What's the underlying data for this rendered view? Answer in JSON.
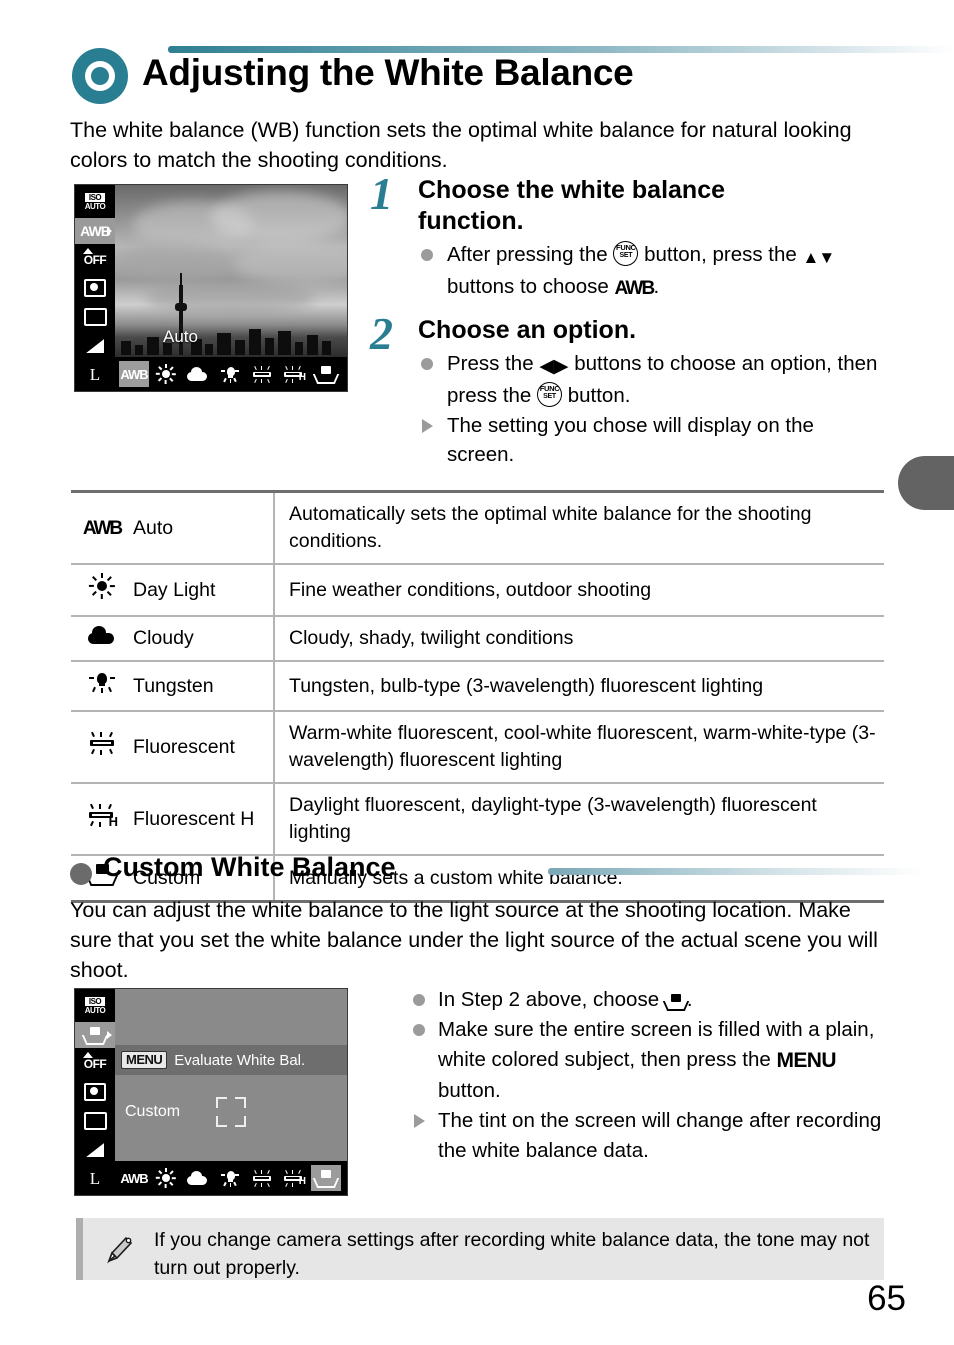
{
  "header": {
    "title": "Adjusting the White Balance",
    "icon": "circle-ring-icon"
  },
  "intro": "The white balance (WB) function sets the optimal white balance for natural looking colors to match the shooting conditions.",
  "camera_screen_1": {
    "rail_icons": [
      "iso-auto-icon",
      "awb-icon",
      "flash-off-icon",
      "metering-icon",
      "drive-frame-icon",
      "compression-wedge-icon",
      "image-size-l-icon"
    ],
    "iso_label_top": "ISO",
    "iso_label_bottom": "AUTO",
    "awb_label": "AWB",
    "flash_off_label": "OFF",
    "size_label": "L",
    "mode_label": "Auto",
    "strip_items": [
      "AWB",
      "day-light-icon",
      "cloudy-icon",
      "tungsten-icon",
      "fluorescent-icon",
      "fluorescent-h-icon",
      "custom-wb-icon"
    ],
    "selected_index": 0
  },
  "steps": [
    {
      "number": "1",
      "heading": "Choose the white balance function.",
      "bullets": [
        {
          "marker": "dot",
          "parts": [
            "After pressing the ",
            "FUNC-SET-button",
            " button, press the ",
            "up-down-arrows",
            " buttons to choose ",
            "AWB-glyph",
            "."
          ]
        }
      ]
    },
    {
      "number": "2",
      "heading": "Choose an option.",
      "bullets": [
        {
          "marker": "dot",
          "parts": [
            "Press the ",
            "left-right-arrows",
            " buttons to choose an option, then press the ",
            "FUNC-SET-button",
            " button."
          ]
        },
        {
          "marker": "triangle",
          "parts": [
            "The setting you chose will display on the screen."
          ]
        }
      ]
    }
  ],
  "step_text": {
    "s1_head_line1": "Choose the white balance",
    "s1_head_line2": "function.",
    "s1_b1_a": "After pressing the",
    "s1_b1_b": "button, press the",
    "s1_b1_c": "buttons to choose",
    "s1_b1_d": ".",
    "s2_head": "Choose an option.",
    "s2_b1_a": "Press the",
    "s2_b1_b": "buttons to choose an option,",
    "s2_b1_c": "then press the",
    "s2_b1_d": "button.",
    "s2_b2": "The setting you chose will display on the screen.",
    "func_top": "FUNC",
    "func_bottom": "SET",
    "up_down": "▲▼",
    "left_right": "◀▶",
    "awb": "AWB"
  },
  "table": {
    "rows": [
      {
        "icon": "awb-icon",
        "name": "Auto",
        "desc": "Automatically sets the optimal white balance for the shooting conditions."
      },
      {
        "icon": "day-light-icon",
        "name": "Day Light",
        "desc": "Fine weather conditions, outdoor shooting"
      },
      {
        "icon": "cloudy-icon",
        "name": "Cloudy",
        "desc": "Cloudy, shady, twilight conditions"
      },
      {
        "icon": "tungsten-icon",
        "name": "Tungsten",
        "desc": "Tungsten, bulb-type (3-wavelength) fluorescent lighting"
      },
      {
        "icon": "fluorescent-icon",
        "name": "Fluorescent",
        "desc": "Warm-white fluorescent, cool-white fluorescent, warm-white-type (3-wavelength) fluorescent lighting"
      },
      {
        "icon": "fluorescent-h-icon",
        "name": "Fluorescent H",
        "desc": "Daylight fluorescent, daylight-type (3-wavelength) fluorescent lighting"
      },
      {
        "icon": "custom-wb-icon",
        "name": "Custom",
        "desc": "Manually sets a custom white balance."
      }
    ],
    "awb_text": "AWB",
    "fluorescent_h_letter": "H"
  },
  "subsection": {
    "title": "Custom White Balance",
    "body": "You can adjust the white balance to the light source at the shooting location. Make sure that you set the white balance under the light source of the actual scene you will shoot."
  },
  "camera_screen_2": {
    "iso_label_top": "ISO",
    "iso_label_bottom": "AUTO",
    "flash_off_label": "OFF",
    "size_label": "L",
    "menu_chip": "MENU",
    "menu_text": "Evaluate White Bal.",
    "mode_label": "Custom",
    "strip_items": [
      "AWB",
      "day-light-icon",
      "cloudy-icon",
      "tungsten-icon",
      "fluorescent-icon",
      "fluorescent-h-icon",
      "custom-wb-icon"
    ],
    "selected_index": 6,
    "strip_awb_text": "AWB"
  },
  "custom_steps": {
    "b1_a": "In Step 2 above, choose",
    "b1_b": ".",
    "b2_a": "Make sure the entire screen is filled with a plain, white colored subject, then press the",
    "b2_menu": "MENU",
    "b2_b": "button.",
    "b3": "The tint on the screen will change after recording the white balance data."
  },
  "note": {
    "icon": "pencil-icon",
    "text": "If you change camera settings after recording white balance data, the tone may not turn out properly."
  },
  "page_number": "65",
  "colors": {
    "accent_teal": "#2a7e92",
    "rule_gray": "#b4b4b4",
    "note_bg": "#e6e6e6",
    "bullet_gray": "#9b9b9b",
    "side_tab": "#636363"
  }
}
